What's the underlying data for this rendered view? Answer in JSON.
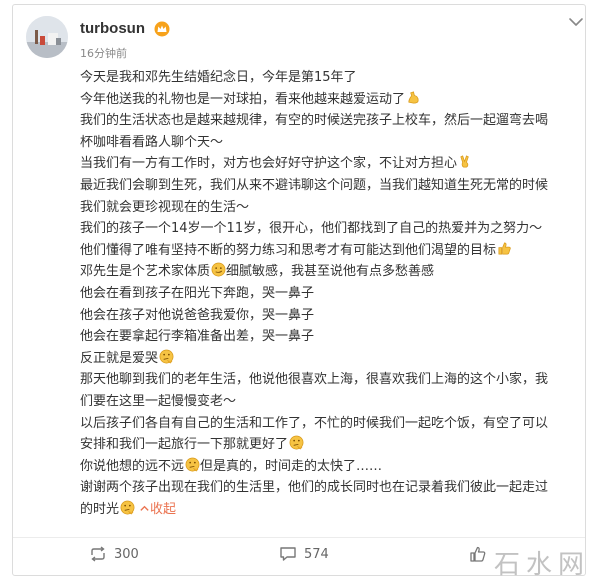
{
  "post": {
    "username": "turbosun",
    "time_ago": "16分钟前",
    "lines": [
      "今天是我和邓先生结婚纪念日，今年是第15年了",
      "今年他送我的礼物也是一对球拍，看来他越来越爱运动了",
      "我们的生活状态也是越来越规律，有空的时候送完孩子上校车，然后一起遛弯去喝",
      "杯咖啡看看路人聊个天～",
      "当我们有一方有工作时，对方也会好好守护这个家，不让对方担心",
      "最近我们会聊到生死，我们从来不避讳聊这个问题，当我们越知道生死无常的时候",
      "我们就会更珍视现在的生活～",
      "我们的孩子一个14岁一个11岁，很开心，他们都找到了自己的热爱并为之努力～",
      "他们懂得了唯有坚持不断的努力练习和思考才有可能达到他们渴望的目标",
      "邓先生是个艺术家体质",
      "他会在看到孩子在阳光下奔跑，哭一鼻子",
      "他会在孩子对他说爸爸我爱你，哭一鼻子",
      "他会在要拿起行李箱准备出差，哭一鼻子",
      "反正就是爱哭",
      "那天他聊到我们的老年生活，他说他很喜欢上海，很喜欢我们上海的这个小家，我",
      "们要在这里一起慢慢变老～",
      "以后孩子们各自有自己的生活和工作了，不忙的时候我们一起吃个饭，有空了可以",
      "安排和我们一起旅行一下那就更好了",
      "你说他想的远不远",
      "谢谢两个孩子出现在我们的生活里，他们的成长同时也在记录着我们彼此一起走过",
      "的时光"
    ],
    "line10_tail_a": "细腻敏感，我甚至说他有点多愁善感",
    "line19_tail_a": "但是真的，时间走的太快了……",
    "collapse_label": "收起"
  },
  "actions": {
    "repost_count": "300",
    "comment_count": "574"
  },
  "watermark": "石水网",
  "icons": {
    "vip": "crown-badge-icon",
    "more": "chevron-down-icon",
    "repost": "repost-icon",
    "comment": "comment-icon"
  },
  "colors": {
    "accent": "#eb7350",
    "text": "#333333",
    "muted": "#888888"
  }
}
